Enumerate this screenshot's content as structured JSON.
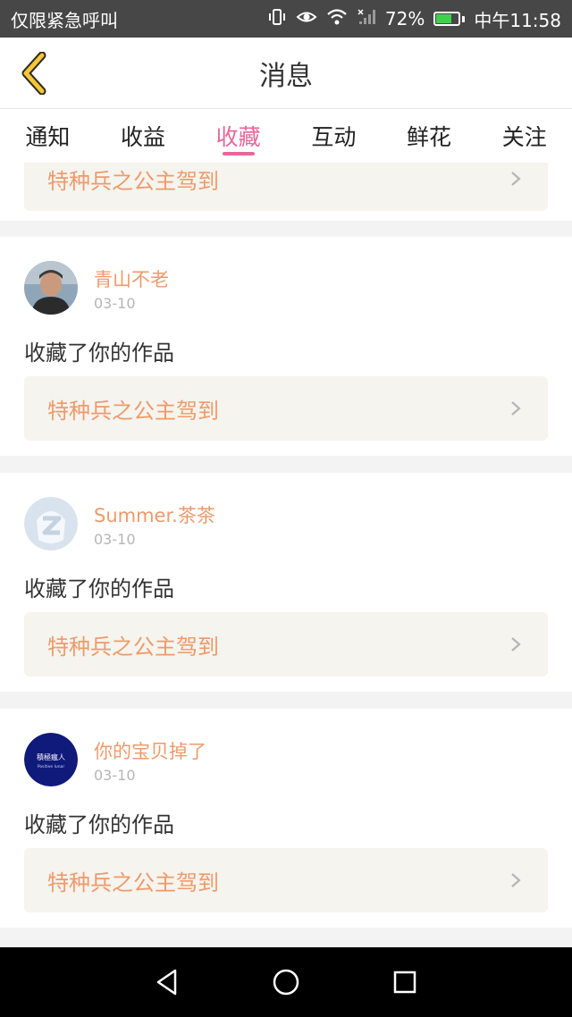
{
  "status_bar": {
    "carrier": "仅限紧急呼叫",
    "battery": "72%",
    "battery_level": 0.72,
    "time": "中午11:58",
    "icons": [
      "vibrate-icon",
      "eye-icon",
      "wifi-icon",
      "signal-icon",
      "battery-icon"
    ]
  },
  "header": {
    "title": "消息"
  },
  "tabs": [
    {
      "label": "通知",
      "active": false
    },
    {
      "label": "收益",
      "active": false
    },
    {
      "label": "收藏",
      "active": true
    },
    {
      "label": "互动",
      "active": false
    },
    {
      "label": "鲜花",
      "active": false
    },
    {
      "label": "关注",
      "active": false
    }
  ],
  "messages": [
    {
      "user": "",
      "date": "",
      "action": "",
      "work_title": "特种兵之公主驾到"
    },
    {
      "user": "青山不老",
      "date": "03-10",
      "action": "收藏了你的作品",
      "work_title": "特种兵之公主驾到"
    },
    {
      "user": "Summer.茶茶",
      "date": "03-10",
      "action": "收藏了你的作品",
      "work_title": "特种兵之公主驾到"
    },
    {
      "user": "你的宝贝掉了",
      "date": "03-10",
      "action": "收藏了你的作品",
      "work_title": "特种兵之公主驾到",
      "avatar_text": "積極瘋人",
      "avatar_subtext": "Positive lunar"
    }
  ],
  "colors": {
    "accent": "#e8679a",
    "username": "#ef9a6b",
    "work_bg": "#f5f4ee"
  }
}
